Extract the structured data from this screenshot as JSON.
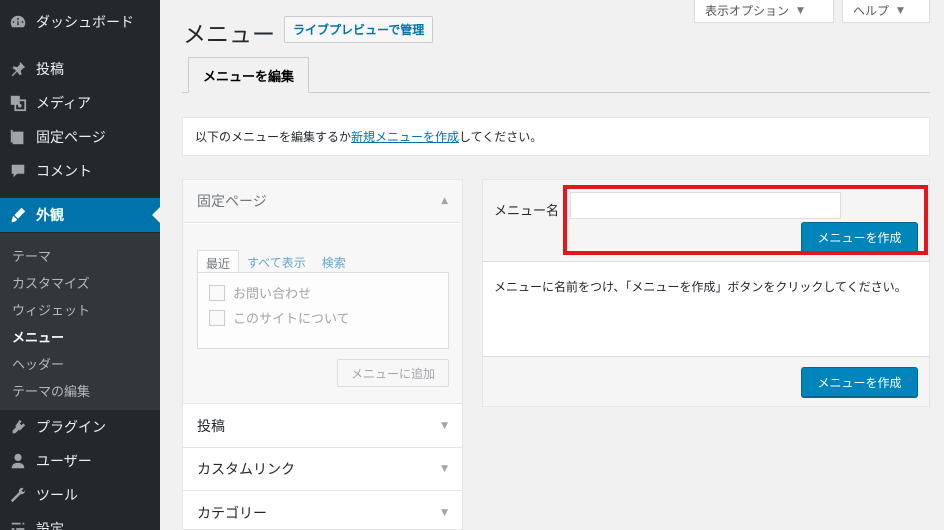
{
  "sidebar": {
    "items": [
      {
        "label": "ダッシュボード",
        "icon": "dashboard-icon"
      },
      {
        "label": "投稿",
        "icon": "pin-icon"
      },
      {
        "label": "メディア",
        "icon": "media-icon"
      },
      {
        "label": "固定ページ",
        "icon": "page-icon"
      },
      {
        "label": "コメント",
        "icon": "comment-icon"
      },
      {
        "label": "外観",
        "icon": "appearance-icon"
      },
      {
        "label": "プラグイン",
        "icon": "plugin-icon"
      },
      {
        "label": "ユーザー",
        "icon": "user-icon"
      },
      {
        "label": "ツール",
        "icon": "tool-icon"
      },
      {
        "label": "設定",
        "icon": "settings-icon"
      }
    ],
    "submenu": [
      "テーマ",
      "カスタマイズ",
      "ウィジェット",
      "メニュー",
      "ヘッダー",
      "テーマの編集"
    ]
  },
  "header": {
    "title": "メニュー",
    "live_preview": "ライブプレビューで管理",
    "screen_options": "表示オプション",
    "help": "ヘルプ"
  },
  "tabs": {
    "edit_menus": "メニューを編集"
  },
  "notice": {
    "prefix": "以下のメニューを編集するか",
    "link": "新規メニューを作成",
    "suffix": "してください。"
  },
  "accordion": {
    "pages_title": "固定ページ",
    "inner_tabs": [
      "最近",
      "すべて表示",
      "検索"
    ],
    "pages": [
      "お問い合わせ",
      "このサイトについて"
    ],
    "add_button": "メニューに追加",
    "posts_title": "投稿",
    "custom_links_title": "カスタムリンク",
    "categories_title": "カテゴリー"
  },
  "editor": {
    "menu_name_label": "メニュー名",
    "menu_name_value": "",
    "create_button_top": "メニューを作成",
    "message": "メニューに名前をつけ、「メニューを作成」ボタンをクリックしてください。",
    "create_button_bottom": "メニューを作成"
  },
  "colors": {
    "accent": "#0073aa",
    "primary_button": "#0085ba",
    "highlight": "#e3161e",
    "sidebar": "#23282d"
  }
}
